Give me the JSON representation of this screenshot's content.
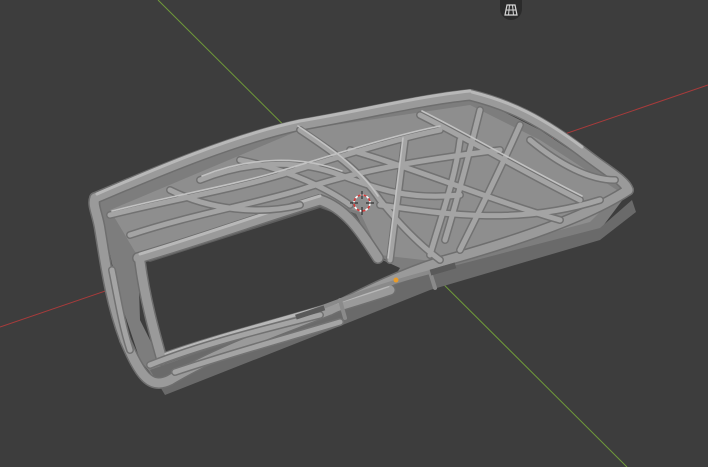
{
  "viewport": {
    "background_color": "#3d3d3d",
    "x_axis_color": "#a83b3b",
    "y_axis_color": "#6f9a3a",
    "mesh_color": "#9a9a9a",
    "mesh_shadow_color": "#6e6e6e",
    "mesh_highlight_color": "#bdbdbd",
    "origin_color": "#e89b2a",
    "cursor_color_a": "#ffffff",
    "cursor_color_b": "#d63a3a"
  },
  "toolbar": {
    "perspective_toggle_icon": "grid-perspective-icon"
  }
}
